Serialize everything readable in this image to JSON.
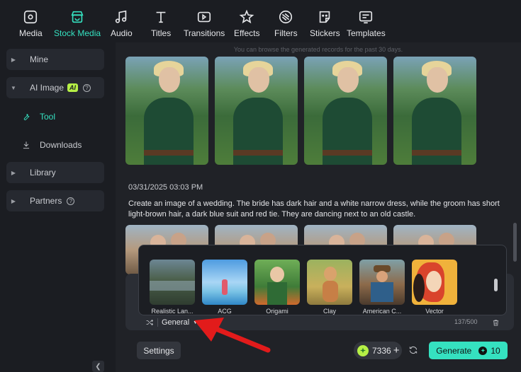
{
  "colors": {
    "accent": "#35e1c0",
    "badge": "#b6f046",
    "arrow": "#e21b1b"
  },
  "toolbar": {
    "items": [
      {
        "label": "Media",
        "icon": "media-icon"
      },
      {
        "label": "Stock Media",
        "icon": "stock-media-icon",
        "active": true
      },
      {
        "label": "Audio",
        "icon": "music-note-icon"
      },
      {
        "label": "Titles",
        "icon": "text-t-icon"
      },
      {
        "label": "Transitions",
        "icon": "transitions-icon"
      },
      {
        "label": "Effects",
        "icon": "effects-star-icon"
      },
      {
        "label": "Filters",
        "icon": "filters-icon"
      },
      {
        "label": "Stickers",
        "icon": "sticker-icon"
      },
      {
        "label": "Templates",
        "icon": "templates-icon"
      }
    ]
  },
  "sidebar": {
    "mine": "Mine",
    "ai_image": "AI Image",
    "ai_badge": "AI",
    "tool": "Tool",
    "downloads": "Downloads",
    "library": "Library",
    "partners": "Partners"
  },
  "main": {
    "notice": "You can browse the generated records for the past 30 days.",
    "record_date": "03/31/2025 03:03 PM",
    "record_prompt": "Create an image of a wedding. The bride has dark hair and a white narrow dress, while the groom has short light-brown hair, a dark blue suit and red tie. They are dancing next to an old castle."
  },
  "styles": {
    "items": [
      {
        "label": "Realistic Lan..."
      },
      {
        "label": "ACG"
      },
      {
        "label": "Origami"
      },
      {
        "label": "Clay"
      },
      {
        "label": "American C..."
      },
      {
        "label": "Vector"
      }
    ]
  },
  "options": {
    "style_value": "General",
    "char_count": "137/500"
  },
  "footer": {
    "settings": "Settings",
    "credits": "7336",
    "generate": "Generate",
    "generate_cost": "10"
  }
}
